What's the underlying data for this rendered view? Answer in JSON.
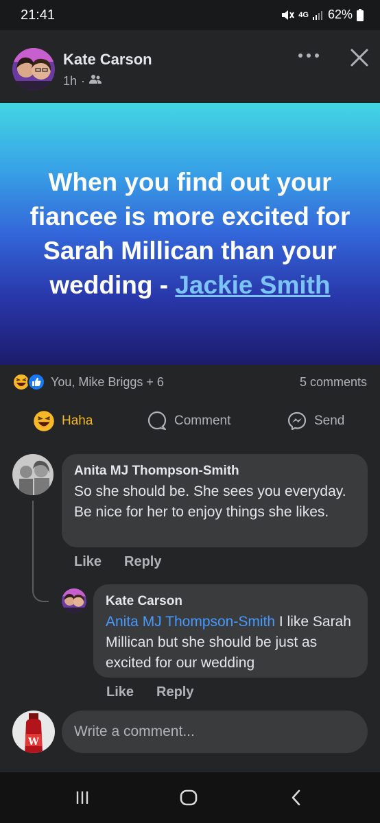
{
  "status": {
    "time": "21:41",
    "network": "4G",
    "battery": "62%"
  },
  "post": {
    "author": "Kate Carson",
    "time": "1h",
    "meta_separator": "·",
    "audience_icon": "friends-icon",
    "banner_text_main": "When you find out your fiancee is more excited for Sarah Millican than your wedding - ",
    "banner_text_link": "Jackie Smith",
    "banner_gradient": [
      "#43d6e3",
      "#3366d9",
      "#1c1c6b"
    ]
  },
  "reactions": {
    "types": [
      "haha",
      "like"
    ],
    "summary": "You, Mike Briggs + 6",
    "comments_count": "5 comments"
  },
  "actions": {
    "haha_label": "Haha",
    "comment_label": "Comment",
    "send_label": "Send"
  },
  "comments": [
    {
      "author": "Anita MJ Thompson-Smith",
      "mention": "",
      "text": "So she should be. She sees you everyday. Be nice for her to enjoy things she likes.",
      "like_label": "Like",
      "reply_label": "Reply"
    },
    {
      "author": "Kate Carson",
      "mention": "Anita MJ Thompson-Smith",
      "text": " I like Sarah Millican but she should be just as excited for our wedding",
      "like_label": "Like",
      "reply_label": "Reply"
    }
  ],
  "composer": {
    "placeholder": "Write a comment..."
  },
  "colors": {
    "accent_link": "#4599ff",
    "haha": "#f7b928",
    "like": "#1877f2"
  }
}
